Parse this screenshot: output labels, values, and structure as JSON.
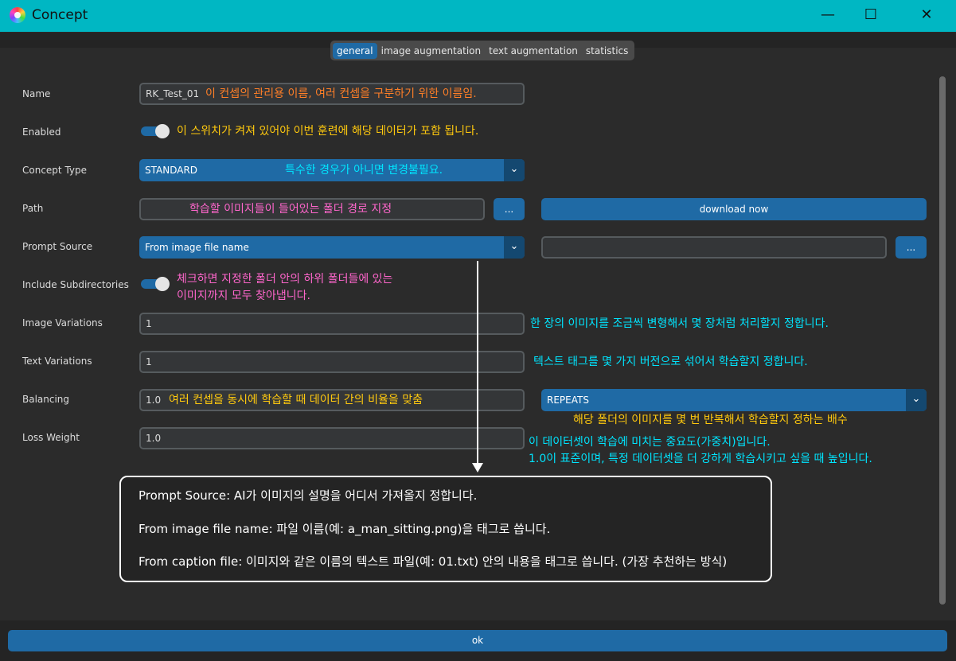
{
  "window": {
    "title": "Concept",
    "minimize": "—",
    "maximize": "☐",
    "close": "✕"
  },
  "tabs": [
    {
      "label": "general",
      "active": true
    },
    {
      "label": "image augmentation",
      "active": false
    },
    {
      "label": "text augmentation",
      "active": false
    },
    {
      "label": "statistics",
      "active": false
    }
  ],
  "form": {
    "name": {
      "label": "Name",
      "value": "RK_Test_01",
      "note": "이 컨셉의 관리용 이름, 여러 컨셉을 구분하기 위한 이름임."
    },
    "enabled": {
      "label": "Enabled",
      "on": true,
      "note": "이 스위치가 켜져 있어야 이번 훈련에 해당 데이터가 포함 됩니다."
    },
    "concept_type": {
      "label": "Concept Type",
      "value": "STANDARD",
      "note": "특수한 경우가 아니면 변경불필요."
    },
    "path": {
      "label": "Path",
      "value": "",
      "note": "학습할 이미지들이 들어있는 폴더 경로 지정",
      "browse": "...",
      "download": "download now"
    },
    "prompt_source": {
      "label": "Prompt Source",
      "value": "From image file name",
      "extra_value": "",
      "browse": "..."
    },
    "include_subdirectories": {
      "label": "Include Subdirectories",
      "on": true,
      "note_line1": "체크하면 지정한 폴더 안의 하위 폴더들에 있는",
      "note_line2": "이미지까지 모두 찾아냅니다."
    },
    "image_variations": {
      "label": "Image Variations",
      "value": "1",
      "note": "한 장의 이미지를 조금씩 변형해서 몇 장처럼 처리할지 정합니다."
    },
    "text_variations": {
      "label": "Text Variations",
      "value": "1",
      "note": "텍스트 태그를 몇 가지 버전으로 섞어서 학습할지 정합니다."
    },
    "balancing": {
      "label": "Balancing",
      "value": "1.0",
      "note": "여러 컨셉을 동시에 학습할 때 데이터 간의 비율을 맞춤",
      "strategy": "REPEATS",
      "strategy_note": "해당 폴더의 이미지를 몇 번 반복해서 학습할지 정하는 배수"
    },
    "loss_weight": {
      "label": "Loss Weight",
      "value": "1.0",
      "note_line1": "이 데이터셋이 학습에 미치는 중요도(가중치)입니다.",
      "note_line2": "1.0이 표준이며, 특정 데이터셋을 더 강하게 학습시키고 싶을 때 높입니다."
    }
  },
  "callout": {
    "line1": "Prompt Source: AI가 이미지의 설명을 어디서 가져올지 정합니다.",
    "line2": "From image file name: 파일 이름(예: a_man_sitting.png)을 태그로 씁니다.",
    "line3": "From caption file: 이미지와 같은 이름의 텍스트 파일(예: 01.txt) 안의 내용을 태그로 씁니다. (가장 추천하는 방식)"
  },
  "ok_label": "ok",
  "colors": {
    "titlebar": "#00b7c3",
    "accent": "#1f6aa5",
    "orange": "#ff7f27",
    "yellow": "#ffc90e",
    "cyan": "#00e5ff",
    "pink": "#ff66cc"
  }
}
